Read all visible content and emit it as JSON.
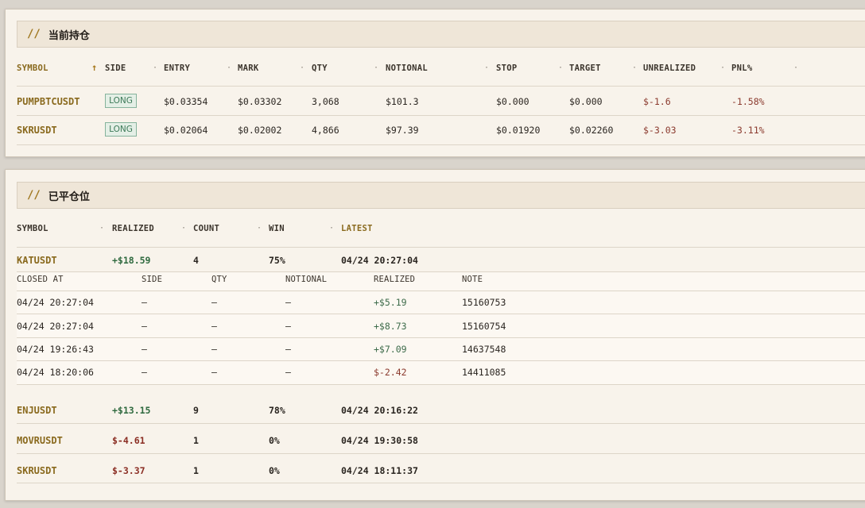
{
  "open_positions": {
    "title": "当前持仓",
    "prefix": "//",
    "columns": [
      "SYMBOL",
      "SIDE",
      "ENTRY",
      "MARK",
      "QTY",
      "NOTIONAL",
      "STOP",
      "TARGET",
      "UNREALIZED",
      "PNL%"
    ],
    "sort_indicator": "↑",
    "separator": "·",
    "rows": [
      {
        "symbol": "PUMPBTCUSDT",
        "side": "LONG",
        "entry": "$0.03354",
        "mark": "$0.03302",
        "qty": "3,068",
        "notional": "$101.3",
        "stop": "$0.000",
        "target": "$0.000",
        "unrealized": "$-1.6",
        "pnl_pct": "-1.58%"
      },
      {
        "symbol": "SKRUSDT",
        "side": "LONG",
        "entry": "$0.02064",
        "mark": "$0.02002",
        "qty": "4,866",
        "notional": "$97.39",
        "stop": "$0.01920",
        "target": "$0.02260",
        "unrealized": "$-3.03",
        "pnl_pct": "-3.11%"
      }
    ]
  },
  "closed_positions": {
    "title": "已平仓位",
    "prefix": "//",
    "columns": [
      "SYMBOL",
      "REALIZED",
      "COUNT",
      "WIN",
      "LATEST"
    ],
    "separator": "·",
    "groups": [
      {
        "symbol": "KATUSDT",
        "realized": "+$18.59",
        "count": "4",
        "win": "75%",
        "latest": "04/24 20:27:04",
        "detail_columns": [
          "CLOSED AT",
          "SIDE",
          "QTY",
          "NOTIONAL",
          "REALIZED",
          "NOTE"
        ],
        "details": [
          {
            "closed_at": "04/24 20:27:04",
            "side": "—",
            "qty": "—",
            "notional": "—",
            "realized": "+$5.19",
            "note": "15160753"
          },
          {
            "closed_at": "04/24 20:27:04",
            "side": "—",
            "qty": "—",
            "notional": "—",
            "realized": "+$8.73",
            "note": "15160754"
          },
          {
            "closed_at": "04/24 19:26:43",
            "side": "—",
            "qty": "—",
            "notional": "—",
            "realized": "+$7.09",
            "note": "14637548"
          },
          {
            "closed_at": "04/24 18:20:06",
            "side": "—",
            "qty": "—",
            "notional": "—",
            "realized": "$-2.42",
            "note": "14411085"
          }
        ]
      },
      {
        "symbol": "ENJUSDT",
        "realized": "+$13.15",
        "count": "9",
        "win": "78%",
        "latest": "04/24 20:16:22"
      },
      {
        "symbol": "MOVRUSDT",
        "realized": "$-4.61",
        "count": "1",
        "win": "0%",
        "latest": "04/24 19:30:58"
      },
      {
        "symbol": "SKRUSDT",
        "realized": "$-3.37",
        "count": "1",
        "win": "0%",
        "latest": "04/24 18:11:37"
      }
    ]
  },
  "colors": {
    "accent_gold": "#8a6a1e",
    "positive": "#2f6a3f",
    "negative": "#8b2e24",
    "long_badge": "#3d7a58"
  }
}
